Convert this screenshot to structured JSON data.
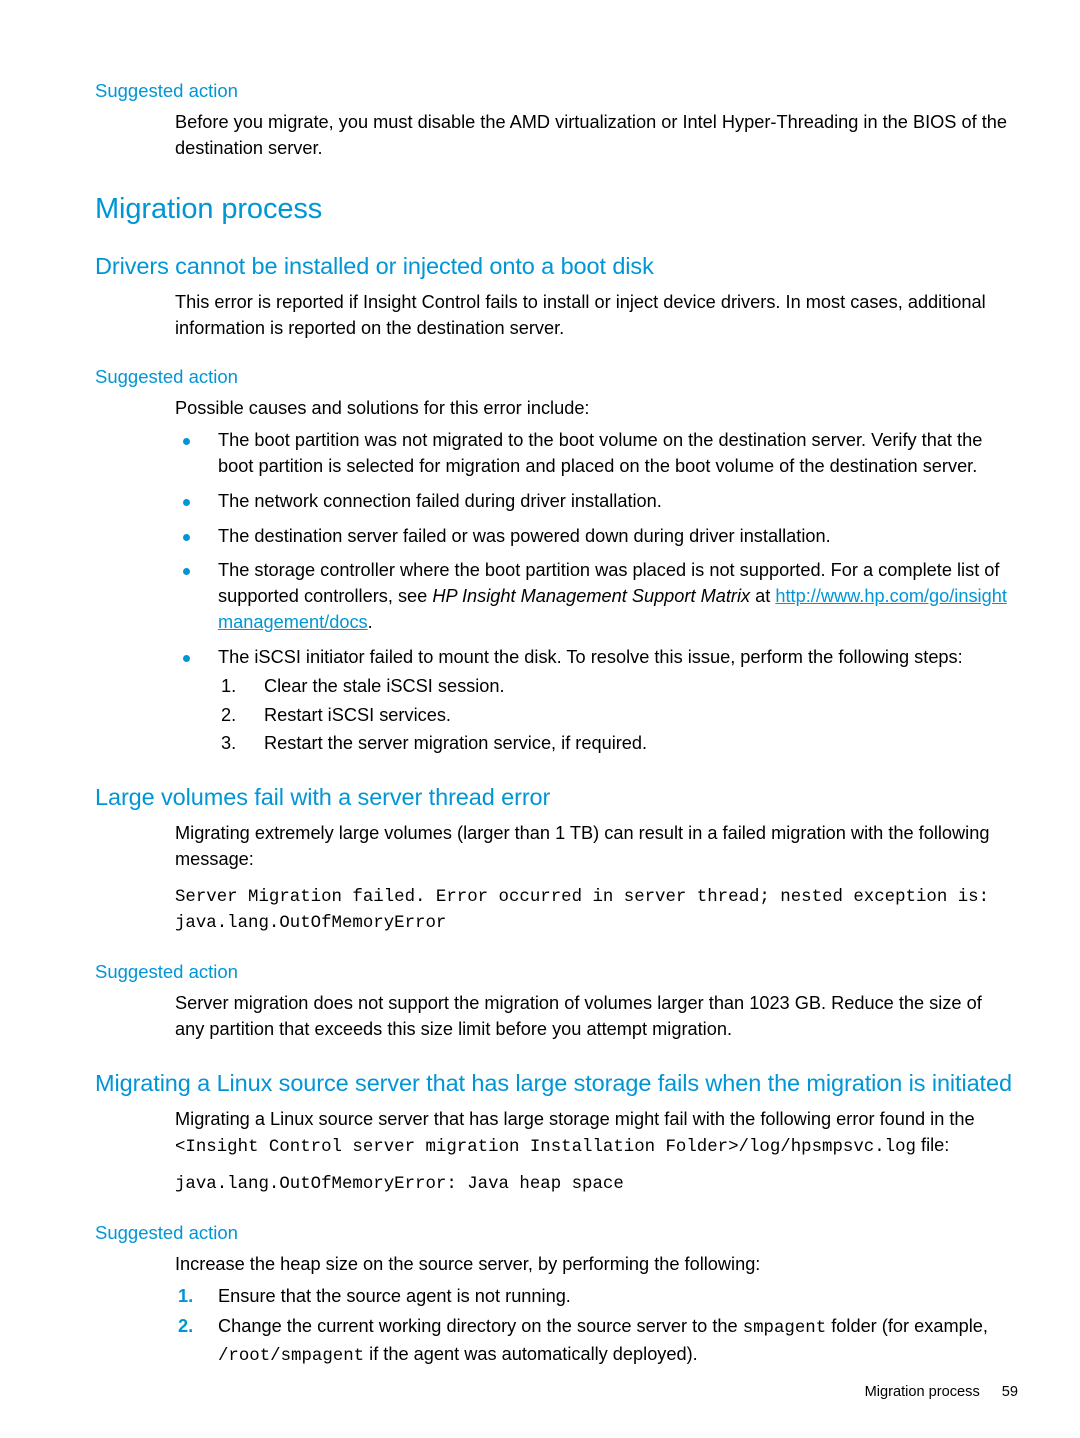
{
  "page": {
    "footer_section": "Migration process",
    "footer_page_number": "59",
    "accent_color": "#0096d6",
    "text_color": "#000000",
    "background_color": "#ffffff"
  },
  "blocks": {
    "suggested_action_1_heading": "Suggested action",
    "suggested_action_1_body": "Before you migrate, you must disable the AMD virtualization or Intel Hyper-Threading in the BIOS of the destination server.",
    "migration_process_heading": "Migration process",
    "drivers_heading": "Drivers cannot be installed or injected onto a boot disk",
    "drivers_body": "This error is reported if Insight Control fails to install or inject device drivers. In most cases, additional information is reported on the destination server.",
    "suggested_action_2_heading": "Suggested action",
    "suggested_action_2_intro": "Possible causes and solutions for this error include:",
    "bullet_1": "The boot partition was not migrated to the boot volume on the destination server. Verify that the boot partition is selected for migration and placed on the boot volume of the destination server.",
    "bullet_2": "The network connection failed during driver installation.",
    "bullet_3": "The destination server failed or was powered down during driver installation.",
    "bullet_4_part1": "The storage controller where the boot partition was placed is not supported. For a complete list of supported controllers, see ",
    "bullet_4_italic": "HP Insight Management Support Matrix",
    "bullet_4_part2": " at ",
    "bullet_4_link": "http://www.hp.com/go/insightmanagement/docs",
    "bullet_4_part3": ".",
    "bullet_5": "The iSCSI initiator failed to mount the disk. To resolve this issue, perform the following steps:",
    "bullet_5_step_1_num": "1.",
    "bullet_5_step_1": "Clear the stale iSCSI session.",
    "bullet_5_step_2_num": "2.",
    "bullet_5_step_2": "Restart iSCSI services.",
    "bullet_5_step_3_num": "3.",
    "bullet_5_step_3": "Restart the server migration service, if required.",
    "large_volumes_heading": "Large volumes fail with a server thread error",
    "large_volumes_body": "Migrating extremely large volumes (larger than 1 TB) can result in a failed migration with the following message:",
    "large_volumes_code": "Server Migration failed. Error occurred in server thread; nested exception is: java.lang.OutOfMemoryError",
    "suggested_action_3_heading": "Suggested action",
    "suggested_action_3_body": "Server migration does not support the migration of volumes larger than 1023 GB. Reduce the size of any partition that exceeds this size limit before you attempt migration.",
    "linux_heading": "Migrating a Linux source server that has large storage fails when the migration is initiated",
    "linux_body_part1": "Migrating a Linux source server that has large storage might fail with the following error found in the ",
    "linux_body_path": "<Insight Control server migration Installation Folder>/log/hpsmpsvc.log",
    "linux_body_part2": " file:",
    "linux_code": "java.lang.OutOfMemoryError: Java heap space",
    "suggested_action_4_heading": "Suggested action",
    "suggested_action_4_intro": "Increase the heap size on the source server, by performing the following:",
    "blue_step_1_num": "1.",
    "blue_step_1": "Ensure that the source agent is not running.",
    "blue_step_2_num": "2.",
    "blue_step_2_part1": "Change the current working directory on the source server to the ",
    "blue_step_2_mono1": "smpagent",
    "blue_step_2_part2": " folder (for example, ",
    "blue_step_2_mono2": "/root/smpagent",
    "blue_step_2_part3": " if the agent was automatically deployed)."
  }
}
